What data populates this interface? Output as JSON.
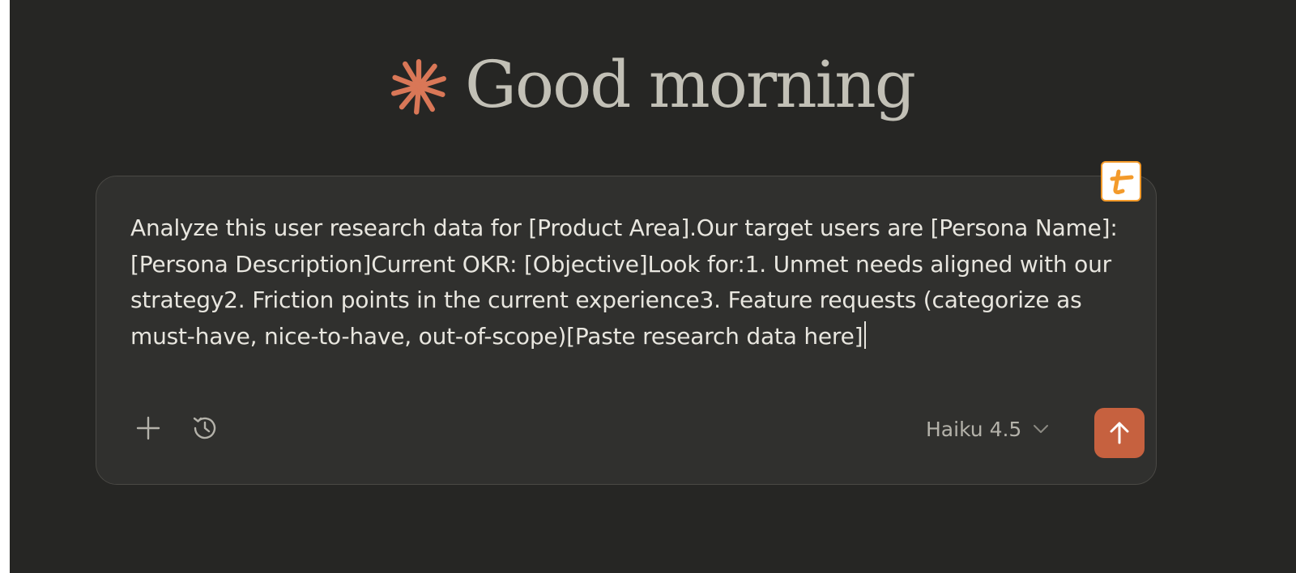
{
  "greeting": {
    "text": "Good morning",
    "icon": "spark-icon",
    "icon_color": "#d97757"
  },
  "composer": {
    "prompt_value": "Analyze this user research data for [Product Area].Our target users are [Persona Name]: [Persona Description]Current OKR: [Objective]Look for:1. Unmet needs aligned with our strategy2. Friction points in the current experience3. Feature requests (categorize as must-have, nice-to-have, out-of-scope)[Paste research data here]",
    "extension_badge_icon": "text-expander-icon",
    "extension_badge_color": "#f39a2a",
    "add_icon": "plus-icon",
    "history_icon": "clock-icon",
    "model": {
      "selected": "Haiku 4.5",
      "icon": "chevron-down-icon"
    },
    "send_icon": "arrow-up-icon",
    "send_color": "#c6613f"
  },
  "colors": {
    "background": "#262624",
    "composer_bg": "#30302e",
    "text": "#e8e6df",
    "greeting_text": "#c2c0b6"
  }
}
